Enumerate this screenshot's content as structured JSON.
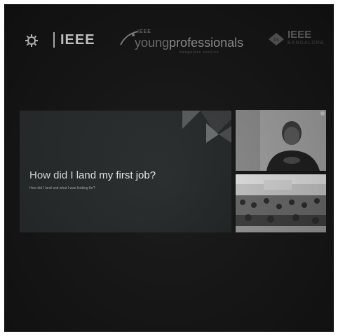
{
  "logos": {
    "ieee": "IEEE",
    "yp_small": "IEEE",
    "yp_main_prefix": "young",
    "yp_main_suffix": "professionals",
    "yp_tagline": "bangalore section",
    "sect_title": "IEEE",
    "sect_subtitle": "BANGALORE"
  },
  "slide": {
    "title": "How did I land my first job?",
    "subtitle": "How did I land and what I was looking for?"
  },
  "icons": [
    "ieee-gear-icon",
    "young-professionals-swoosh-icon",
    "section-emblem-icon"
  ]
}
